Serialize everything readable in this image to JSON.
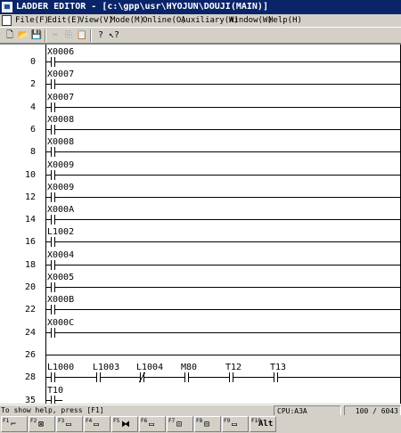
{
  "window": {
    "title": "LADDER EDITOR - [c:\\gpp\\usr\\HYOJUN\\DOUJI(MAIN)]"
  },
  "menu": [
    {
      "label": "File(F)"
    },
    {
      "label": "Edit(E)"
    },
    {
      "label": "View(V)"
    },
    {
      "label": "Mode(M)"
    },
    {
      "label": "Online(O)"
    },
    {
      "label": "Auxiliary(A)"
    },
    {
      "label": "Window(W)"
    },
    {
      "label": "Help(H)"
    }
  ],
  "toolbar": [
    {
      "icon": "new-file-icon",
      "glyph": "🗋"
    },
    {
      "icon": "open-folder-icon",
      "glyph": "📂"
    },
    {
      "icon": "save-icon",
      "glyph": "💾"
    },
    {
      "icon": "cut-icon",
      "glyph": "✂",
      "disabled": true
    },
    {
      "icon": "copy-icon",
      "glyph": "⎘",
      "disabled": true
    },
    {
      "icon": "paste-icon",
      "glyph": "📋",
      "disabled": true
    },
    {
      "icon": "help-icon",
      "glyph": "?"
    },
    {
      "icon": "context-help-icon",
      "glyph": "↖?"
    }
  ],
  "rungs": [
    {
      "step": "0",
      "contact": "X0006"
    },
    {
      "step": "2",
      "contact": "X0007"
    },
    {
      "step": "4",
      "contact": "X0007"
    },
    {
      "step": "6",
      "contact": "X0008"
    },
    {
      "step": "8",
      "contact": "X0008"
    },
    {
      "step": "10",
      "contact": "X0009"
    },
    {
      "step": "12",
      "contact": "X0009"
    },
    {
      "step": "14",
      "contact": "X000A"
    },
    {
      "step": "16",
      "contact": "L1002"
    },
    {
      "step": "18",
      "contact": "X0004"
    },
    {
      "step": "20",
      "contact": "X0005"
    },
    {
      "step": "22",
      "contact": "X000B"
    },
    {
      "step": "24",
      "contact": "X000C"
    }
  ],
  "series_rung": {
    "step": "28",
    "contacts": [
      {
        "label": "L1000",
        "type": "NO"
      },
      {
        "label": "L1003",
        "type": "NO"
      },
      {
        "label": "L1004",
        "type": "NC"
      },
      {
        "label": "M80",
        "type": "NO"
      },
      {
        "label": "T12",
        "type": "NO"
      },
      {
        "label": "T13",
        "type": "NO"
      }
    ]
  },
  "last_rung": {
    "step": "35",
    "contact": "T10"
  },
  "extra_step": "26",
  "status": {
    "help": "To show help, press [F1]",
    "cpu": "CPU:A3A",
    "steps": "100  /  6043"
  },
  "fkeys": [
    {
      "key": "F1",
      "glyph": "⌐"
    },
    {
      "key": "F2",
      "glyph": "⊠"
    },
    {
      "key": "F3",
      "glyph": "▭"
    },
    {
      "key": "F4",
      "glyph": "▭"
    },
    {
      "key": "F5",
      "glyph": "⧓"
    },
    {
      "key": "F6",
      "glyph": "▭"
    },
    {
      "key": "F7",
      "glyph": "⊡"
    },
    {
      "key": "F8",
      "glyph": "⊟"
    },
    {
      "key": "F9",
      "glyph": "▭"
    },
    {
      "key": "F10",
      "glyph": "Alt"
    }
  ]
}
